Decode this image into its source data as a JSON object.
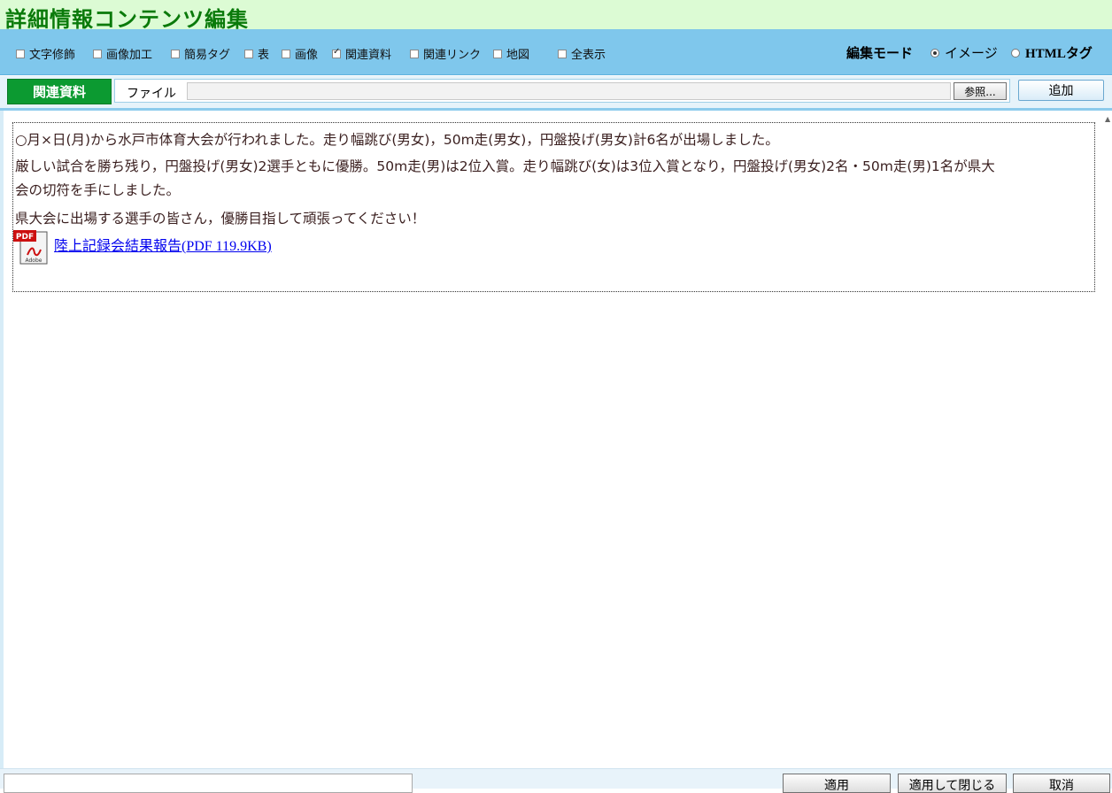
{
  "window": {
    "title": "詳細情報コンテンツ編集"
  },
  "toolbar": {
    "options": [
      {
        "label": "文字修飾",
        "checked": false
      },
      {
        "label": "画像加工",
        "checked": false
      },
      {
        "label": "簡易タグ",
        "checked": false
      },
      {
        "label": "表",
        "checked": false
      },
      {
        "label": "画像",
        "checked": false
      },
      {
        "label": "関連資料",
        "checked": true
      },
      {
        "label": "関連リンク",
        "checked": false
      },
      {
        "label": "地図",
        "checked": false
      },
      {
        "label": "全表示",
        "checked": false
      }
    ],
    "mode_label": "編集モード",
    "mode_image": "イメージ",
    "mode_html": "HTMLタグ",
    "selected_mode": "イメージ"
  },
  "file_panel": {
    "section_label": "関連資料",
    "file_label": "ファイル",
    "file_value": "",
    "browse_label": "参照...",
    "add_label": "追加"
  },
  "content": {
    "paragraphs": [
      "○月×日(月)から水戸市体育大会が行われました。走り幅跳び(男女)，50m走(男女)，円盤投げ(男女)計6名が出場しました。",
      "厳しい試合を勝ち残り，円盤投げ(男女)2選手ともに優勝。50m走(男)は2位入賞。走り幅跳び(女)は3位入賞となり，円盤投げ(男女)2名・50m走(男)1名が県大",
      "会の切符を手にしました。",
      "県大会に出場する選手の皆さん，優勝目指して頑張ってください！"
    ],
    "pdf_link": "陸上記録会結果報告(PDF 119.9KB)",
    "pdf_icon_text": "PDF",
    "pdf_icon_brand": "Adobe"
  },
  "bottom": {
    "status_value": "",
    "apply_label": "適用",
    "apply_close_label": "適用して閉じる",
    "cancel_label": "取消"
  }
}
